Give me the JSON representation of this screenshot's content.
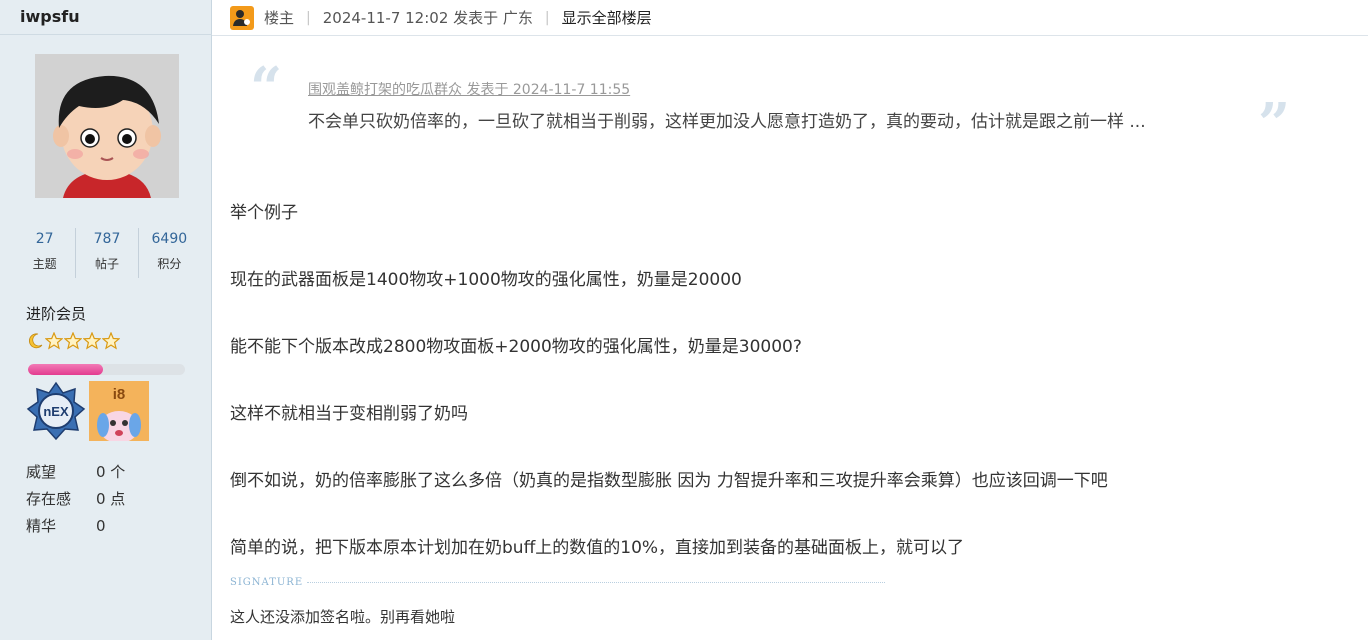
{
  "user": {
    "name": "iwpsfu",
    "stats": [
      {
        "value": "27",
        "label": "主题"
      },
      {
        "value": "787",
        "label": "帖子"
      },
      {
        "value": "6490",
        "label": "积分"
      }
    ],
    "rank": "进阶会员",
    "rank_stars": 5,
    "progress_fraction": 0.48,
    "profile": [
      {
        "key": "威望",
        "value": "0 个"
      },
      {
        "key": "存在感",
        "value": "0 点"
      },
      {
        "key": "精华",
        "value": "0"
      }
    ],
    "medal_text": "i8"
  },
  "post_header": {
    "role": "楼主",
    "posted": "2024-11-7 12:02 发表于 广东",
    "show_all": "显示全部楼层"
  },
  "quote": {
    "meta": "围观盖鲸打架的吃瓜群众 发表于 2024-11-7 11:55",
    "text": "不会单只砍奶倍率的，一旦砍了就相当于削弱，这样更加没人愿意打造奶了，真的要动，估计就是跟之前一样 ..."
  },
  "body": [
    "举个例子",
    "现在的武器面板是1400物攻+1000物攻的强化属性，奶量是20000",
    "能不能下个版本改成2800物攻面板+2000物攻的强化属性，奶量是30000?",
    "这样不就相当于变相削弱了奶吗",
    "倒不如说，奶的倍率膨胀了这么多倍（奶真的是指数型膨胀 因为 力智提升率和三攻提升率会乘算）也应该回调一下吧",
    "简单的说，把下版本原本计划加在奶buff上的数值的10%，直接加到装备的基础面板上，就可以了"
  ],
  "signature": {
    "label": "SIGNATURE",
    "text": "这人还没添加签名啦。别再看她啦"
  },
  "colors": {
    "sidebar_bg": "#e5edf2",
    "stat_number": "#336699",
    "progress": "#e33b8f",
    "author_icon": "#f39a1a"
  }
}
